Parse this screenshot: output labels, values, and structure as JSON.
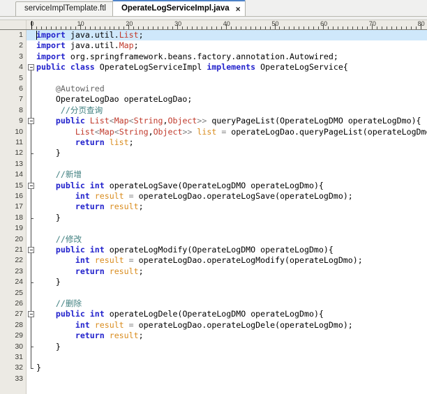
{
  "window": {
    "type": "java-code-editor"
  },
  "tabs": [
    {
      "label": "serviceImplTemplate.ftl",
      "active": false
    },
    {
      "label": "OperateLogServiceImpl.java",
      "active": true,
      "close_icon": "×"
    }
  ],
  "ruler": {
    "labels": [
      "0",
      "10",
      "20",
      "30",
      "40",
      "50",
      "60",
      "70",
      "80"
    ],
    "max_column": 80,
    "caret_column": 0
  },
  "editor": {
    "current_line": 1,
    "total_lines": 33,
    "line_numbers": [
      "1",
      "2",
      "3",
      "4",
      "5",
      "6",
      "7",
      "8",
      "9",
      "10",
      "11",
      "12",
      "13",
      "14",
      "15",
      "16",
      "17",
      "18",
      "19",
      "20",
      "21",
      "22",
      "23",
      "24",
      "25",
      "26",
      "27",
      "28",
      "29",
      "30",
      "31",
      "32",
      "33"
    ],
    "fold_markers": [
      4,
      9,
      15,
      21,
      27
    ],
    "lines": [
      {
        "n": 1,
        "text": "import java.util.List;"
      },
      {
        "n": 2,
        "text": "import java.util.Map;"
      },
      {
        "n": 3,
        "text": "import org.springframework.beans.factory.annotation.Autowired;"
      },
      {
        "n": 4,
        "text": "public class OperateLogServiceImpl implements OperateLogService{"
      },
      {
        "n": 5,
        "text": ""
      },
      {
        "n": 6,
        "text": "    @Autowired"
      },
      {
        "n": 7,
        "text": "    OperateLogDao operateLogDao;"
      },
      {
        "n": 8,
        "text": "     //分页查询"
      },
      {
        "n": 9,
        "text": "    public List<Map<String,Object>> queryPageList(OperateLogDMO operateLogDmo){"
      },
      {
        "n": 10,
        "text": "        List<Map<String,Object>> list = operateLogDao.queryPageList(operateLogDmo);"
      },
      {
        "n": 11,
        "text": "        return list;"
      },
      {
        "n": 12,
        "text": "    }"
      },
      {
        "n": 13,
        "text": ""
      },
      {
        "n": 14,
        "text": "    //新增"
      },
      {
        "n": 15,
        "text": "    public int operateLogSave(OperateLogDMO operateLogDmo){"
      },
      {
        "n": 16,
        "text": "        int result = operateLogDao.operateLogSave(operateLogDmo);"
      },
      {
        "n": 17,
        "text": "        return result;"
      },
      {
        "n": 18,
        "text": "    }"
      },
      {
        "n": 19,
        "text": ""
      },
      {
        "n": 20,
        "text": "    //修改"
      },
      {
        "n": 21,
        "text": "    public int operateLogModify(OperateLogDMO operateLogDmo){"
      },
      {
        "n": 22,
        "text": "        int result = operateLogDao.operateLogModify(operateLogDmo);"
      },
      {
        "n": 23,
        "text": "        return result;"
      },
      {
        "n": 24,
        "text": "    }"
      },
      {
        "n": 25,
        "text": ""
      },
      {
        "n": 26,
        "text": "    //删除"
      },
      {
        "n": 27,
        "text": "    public int operateLogDele(OperateLogDMO operateLogDmo){"
      },
      {
        "n": 28,
        "text": "        int result = operateLogDao.operateLogDele(operateLogDmo);"
      },
      {
        "n": 29,
        "text": "        return result;"
      },
      {
        "n": 30,
        "text": "    }"
      },
      {
        "n": 31,
        "text": ""
      },
      {
        "n": 32,
        "text": "}"
      },
      {
        "n": 33,
        "text": ""
      }
    ]
  },
  "colors": {
    "keyword": "#7f0055",
    "keyword_modifier": "#2222cc",
    "type": "#c0392b",
    "comment": "#3f7f7f",
    "annotation": "#646464",
    "variable": "#d98c1e",
    "operator": "#808080",
    "current_line_highlight": "#cfe8fb",
    "tab_active_border": "#4d82c8",
    "chrome": "#f0f0ef"
  }
}
